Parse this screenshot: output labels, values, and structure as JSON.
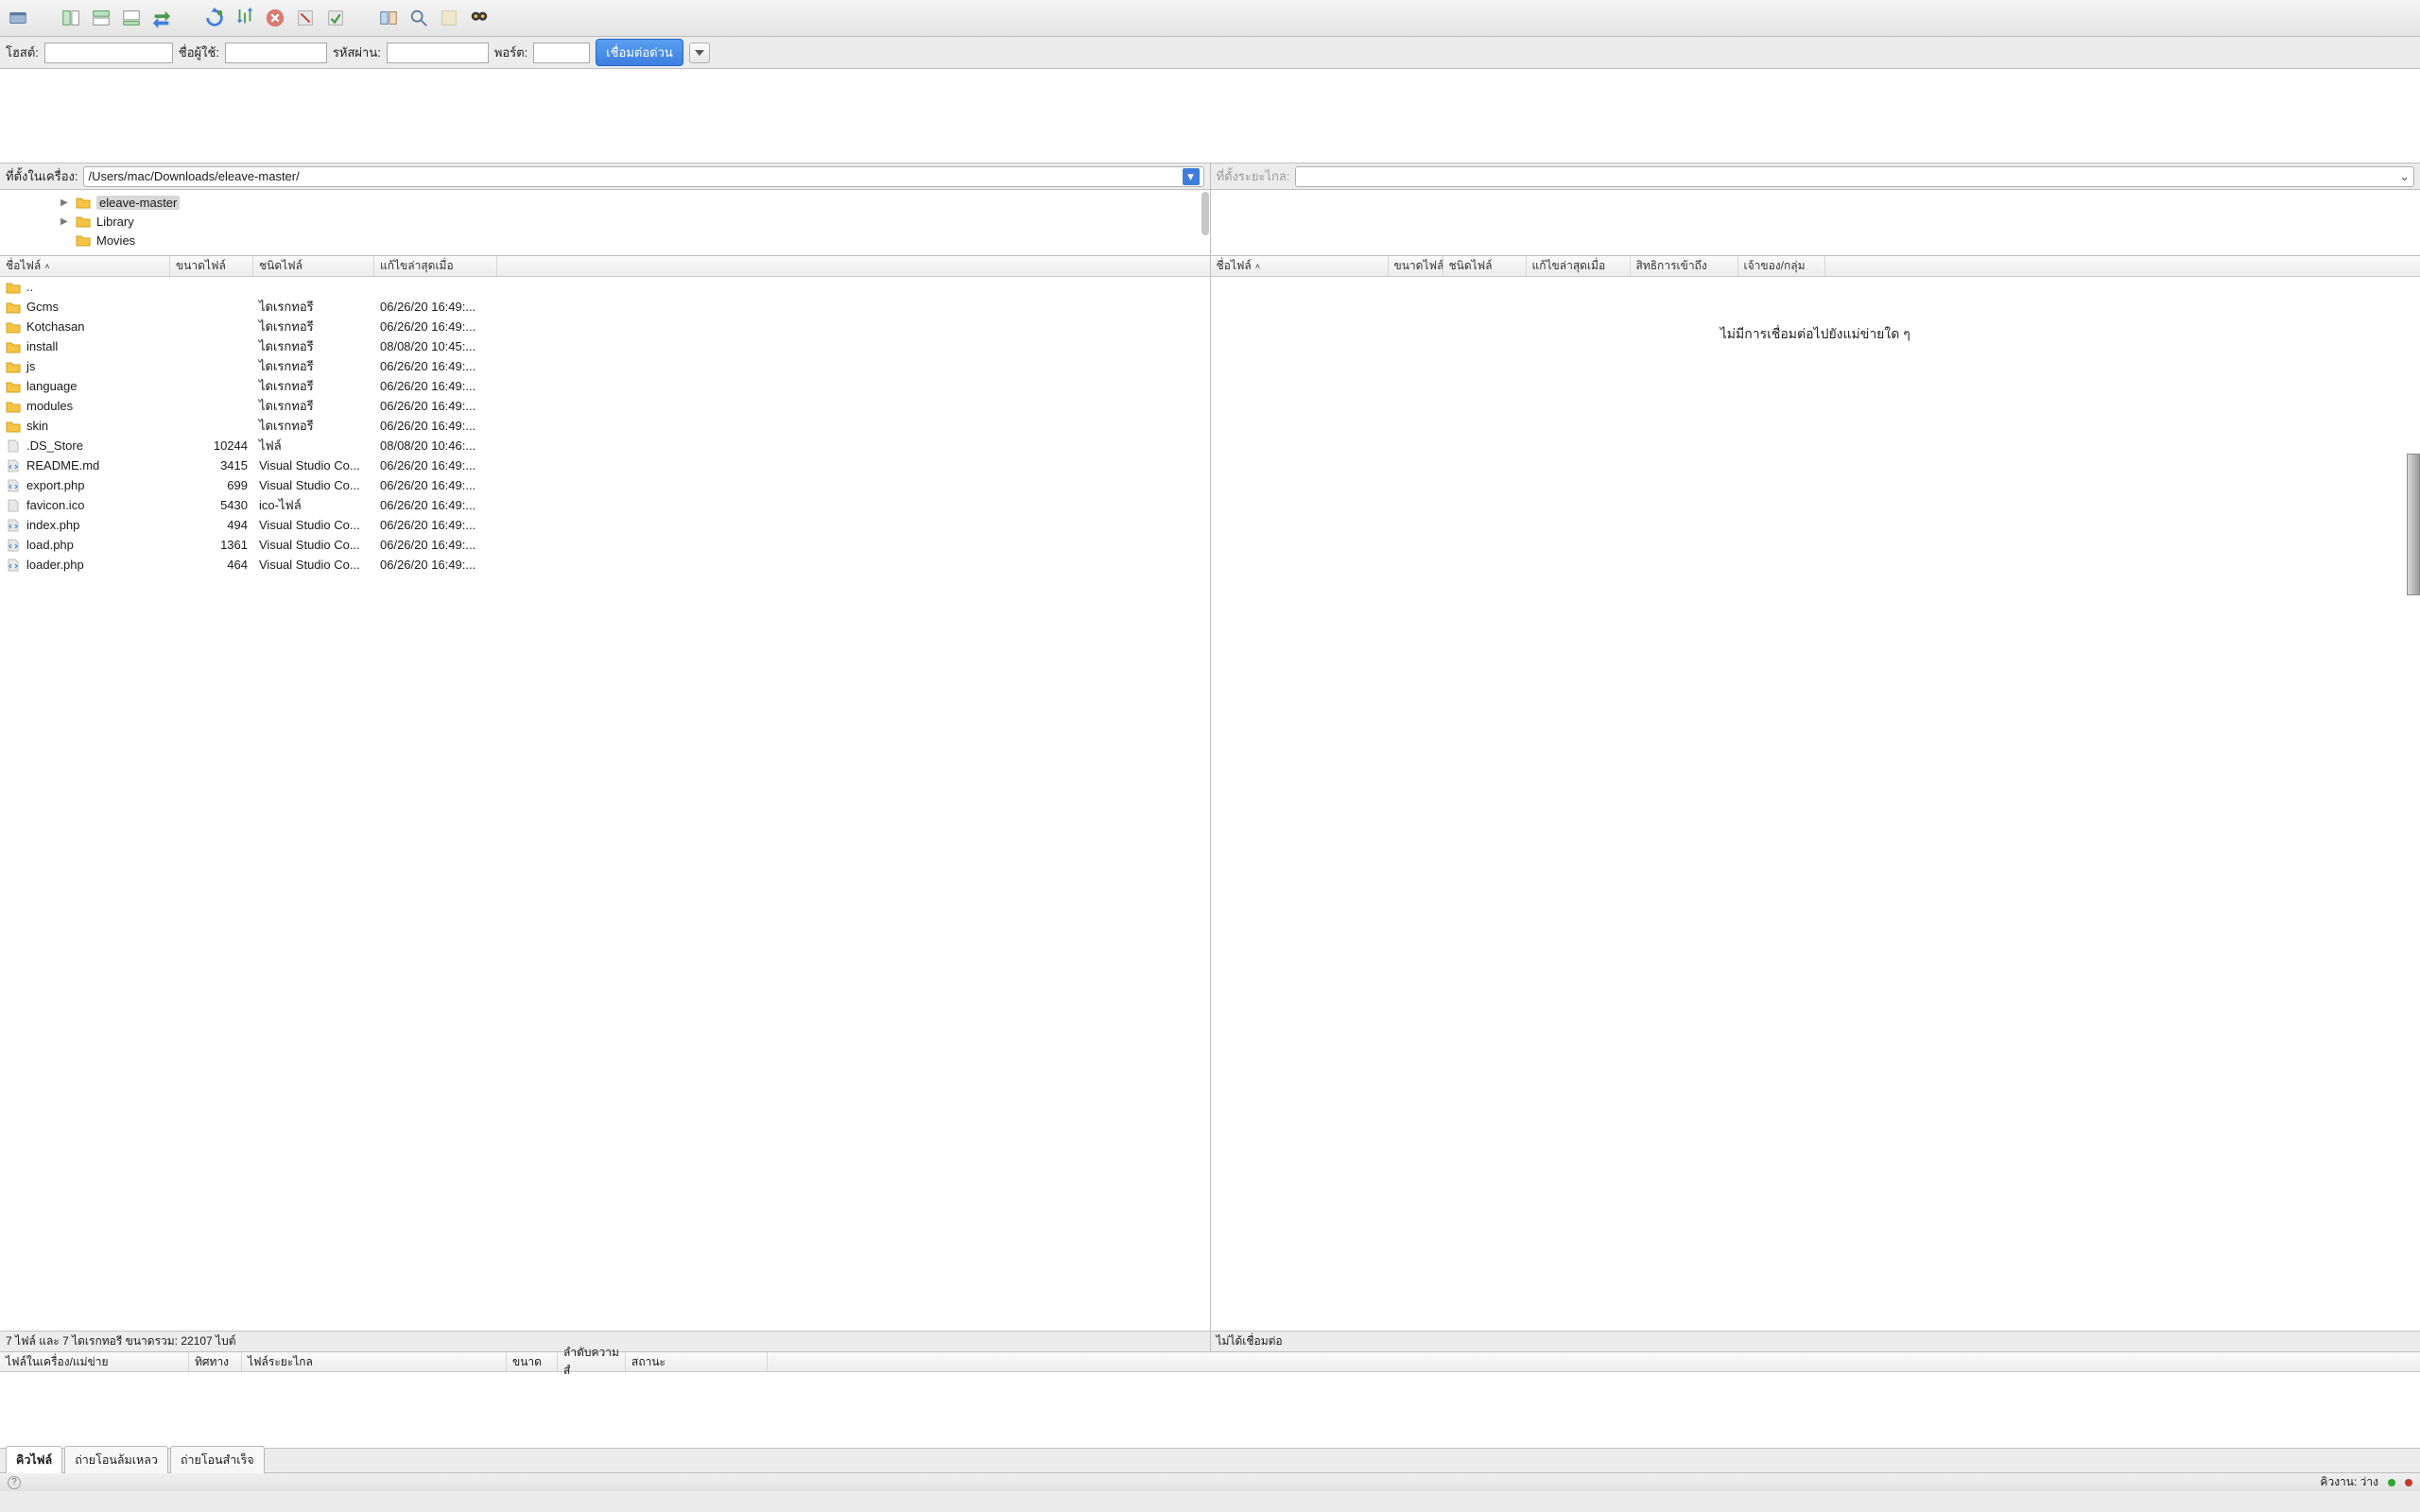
{
  "toolbar_icons": [
    "site-manager",
    "tile",
    "new-tab",
    "swap",
    "spacer",
    "refresh",
    "sort",
    "cancel",
    "clear-done",
    "clear-all",
    "spacer",
    "compare",
    "search",
    "bookmark",
    "binoculars"
  ],
  "quickbar": {
    "host_label": "โฮสต์:",
    "user_label": "ชื่อผู้ใช้:",
    "pass_label": "รหัสผ่าน:",
    "port_label": "พอร์ต:",
    "connect_label": "เชื่อมต่อด่วน"
  },
  "local": {
    "path_label": "ที่ตั้งในเครื่อง:",
    "path_value": "/Users/mac/Downloads/eleave-master/",
    "tree": [
      {
        "name": "eleave-master",
        "selected": true,
        "disclosure": true
      },
      {
        "name": "Library",
        "disclosure": true
      },
      {
        "name": "Movies",
        "disclosure": false
      }
    ],
    "headers": {
      "name": "ชื่อไฟล์",
      "size": "ขนาดไฟล์",
      "type": "ชนิดไฟล์",
      "modified": "แก้ไขล่าสุดเมื่อ"
    },
    "files": [
      {
        "icon": "folder",
        "name": "..",
        "size": "",
        "type": "",
        "mod": ""
      },
      {
        "icon": "folder",
        "name": "Gcms",
        "size": "",
        "type": "ไดเรกทอรี",
        "mod": "06/26/20 16:49:..."
      },
      {
        "icon": "folder",
        "name": "Kotchasan",
        "size": "",
        "type": "ไดเรกทอรี",
        "mod": "06/26/20 16:49:..."
      },
      {
        "icon": "folder",
        "name": "install",
        "size": "",
        "type": "ไดเรกทอรี",
        "mod": "08/08/20 10:45:..."
      },
      {
        "icon": "folder",
        "name": "js",
        "size": "",
        "type": "ไดเรกทอรี",
        "mod": "06/26/20 16:49:..."
      },
      {
        "icon": "folder",
        "name": "language",
        "size": "",
        "type": "ไดเรกทอรี",
        "mod": "06/26/20 16:49:..."
      },
      {
        "icon": "folder",
        "name": "modules",
        "size": "",
        "type": "ไดเรกทอรี",
        "mod": "06/26/20 16:49:..."
      },
      {
        "icon": "folder",
        "name": "skin",
        "size": "",
        "type": "ไดเรกทอรี",
        "mod": "06/26/20 16:49:..."
      },
      {
        "icon": "file",
        "name": ".DS_Store",
        "size": "10244",
        "type": "ไฟล์",
        "mod": "08/08/20 10:46:..."
      },
      {
        "icon": "code",
        "name": "README.md",
        "size": "3415",
        "type": "Visual Studio Co...",
        "mod": "06/26/20 16:49:..."
      },
      {
        "icon": "code",
        "name": "export.php",
        "size": "699",
        "type": "Visual Studio Co...",
        "mod": "06/26/20 16:49:..."
      },
      {
        "icon": "file",
        "name": "favicon.ico",
        "size": "5430",
        "type": "ico-ไฟล์",
        "mod": "06/26/20 16:49:..."
      },
      {
        "icon": "code",
        "name": "index.php",
        "size": "494",
        "type": "Visual Studio Co...",
        "mod": "06/26/20 16:49:..."
      },
      {
        "icon": "code",
        "name": "load.php",
        "size": "1361",
        "type": "Visual Studio Co...",
        "mod": "06/26/20 16:49:..."
      },
      {
        "icon": "code",
        "name": "loader.php",
        "size": "464",
        "type": "Visual Studio Co...",
        "mod": "06/26/20 16:49:..."
      }
    ],
    "status": "7 ไฟล์ และ 7 ไดเรกทอรี ขนาดรวม: 22107 ไบต์"
  },
  "remote": {
    "path_label": "ที่ตั้งระยะไกล:",
    "headers": {
      "name": "ชื่อไฟล์",
      "size": "ขนาดไฟล์",
      "type": "ชนิดไฟล์",
      "modified": "แก้ไขล่าสุดเมื่อ",
      "perm": "สิทธิการเข้าถึง",
      "owner": "เจ้าของ/กลุ่ม"
    },
    "empty": "ไม่มีการเชื่อมต่อไปยังแม่ข่ายใด ๆ",
    "status": "ไม่ได้เชื่อมต่อ"
  },
  "queue": {
    "headers": {
      "file": "ไฟล์ในเครื่อง/แม่ข่าย",
      "dir": "ทิศทาง",
      "remote": "ไฟล์ระยะไกล",
      "size": "ขนาด",
      "prio": "ลำดับความสํ",
      "status": "สถานะ"
    },
    "tabs": [
      {
        "label": "คิวไฟล์",
        "active": true
      },
      {
        "label": "ถ่ายโอนล้มเหลว",
        "active": false
      },
      {
        "label": "ถ่ายโอนสำเร็จ",
        "active": false
      }
    ]
  },
  "footer": {
    "queue_label": "คิวงาน: ว่าง"
  }
}
